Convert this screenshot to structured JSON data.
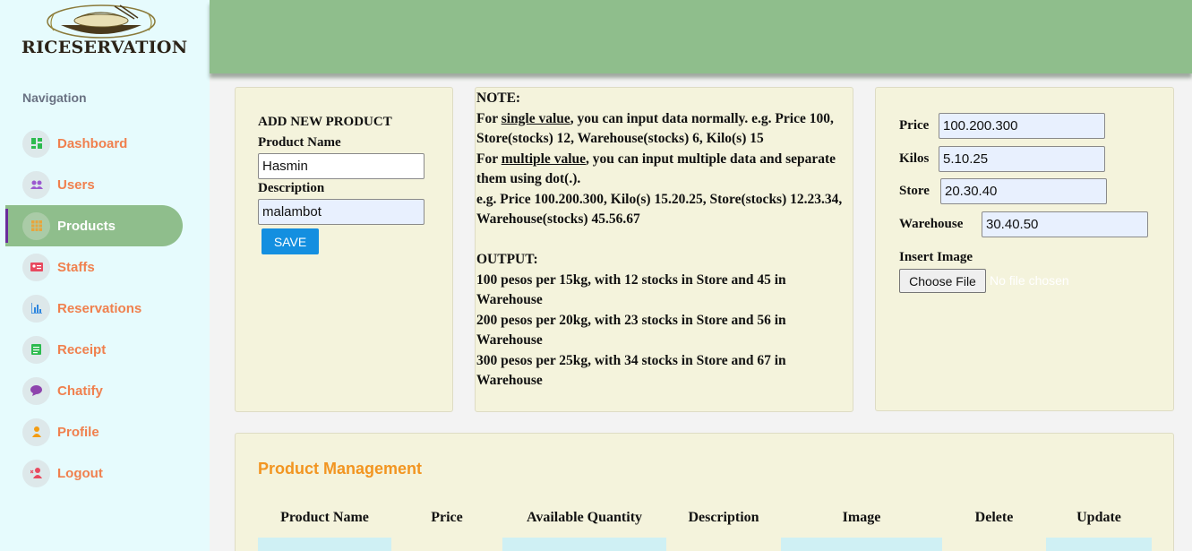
{
  "brand": {
    "name": "RICESERVATION"
  },
  "sidebar": {
    "heading": "Navigation",
    "items": [
      {
        "label": "Dashboard",
        "icon": "dashboard-icon",
        "icon_color": "#2dbb4f"
      },
      {
        "label": "Users",
        "icon": "users-icon",
        "icon_color": "#9b59d0"
      },
      {
        "label": "Products",
        "icon": "grid-icon",
        "icon_color": "#e8a53c",
        "active": true
      },
      {
        "label": "Staffs",
        "icon": "id-card-icon",
        "icon_color": "#e84a5f"
      },
      {
        "label": "Reservations",
        "icon": "bar-chart-icon",
        "icon_color": "#2e86de"
      },
      {
        "label": "Receipt",
        "icon": "receipt-icon",
        "icon_color": "#2dbb4f"
      },
      {
        "label": "Chatify",
        "icon": "chat-icon",
        "icon_color": "#8e44ad"
      },
      {
        "label": "Profile",
        "icon": "person-icon",
        "icon_color": "#f39c12"
      },
      {
        "label": "Logout",
        "icon": "person-remove-icon",
        "icon_color": "#e84a5f"
      }
    ]
  },
  "add_product": {
    "title": "ADD NEW PRODUCT",
    "name_label": "Product Name",
    "name_value": "Hasmin",
    "description_label": "Description",
    "description_value": "malambot",
    "save_label": "SAVE"
  },
  "note": {
    "heading": "NOTE:",
    "single_pre": "For ",
    "single_term": "single value",
    "single_post": ", you can input data normally. e.g. Price 100, Store(stocks) 12, Warehouse(stocks) 6, Kilo(s) 15",
    "multiple_pre": "For ",
    "multiple_term": "multiple value",
    "multiple_post": ", you can input multiple data and separate them using dot(.).",
    "example": "e.g. Price 100.200.300, Kilo(s) 15.20.25, Store(stocks) 12.23.34, Warehouse(stocks) 45.56.67",
    "output_heading": "OUTPUT:",
    "output_lines": [
      "100 pesos per 15kg, with 12 stocks in Store and 45 in Warehouse",
      "200 pesos per 20kg, with 23 stocks in Store and 56 in Warehouse",
      "300 pesos per 25kg, with 34 stocks in Store and 67 in Warehouse"
    ]
  },
  "values": {
    "price_label": "Price",
    "price_value": "100.200.300",
    "kilos_label": "Kilos",
    "kilos_value": "5.10.25",
    "store_label": "Store",
    "store_value": "20.30.40",
    "warehouse_label": "Warehouse",
    "warehouse_value": "30.40.50",
    "image_label": "Insert Image",
    "file_button": "Choose File",
    "file_status": "No file chosen"
  },
  "management": {
    "title": "Product Management",
    "columns": [
      "Product Name",
      "Price",
      "Available Quantity",
      "Description",
      "Image",
      "Delete",
      "Update"
    ]
  }
}
